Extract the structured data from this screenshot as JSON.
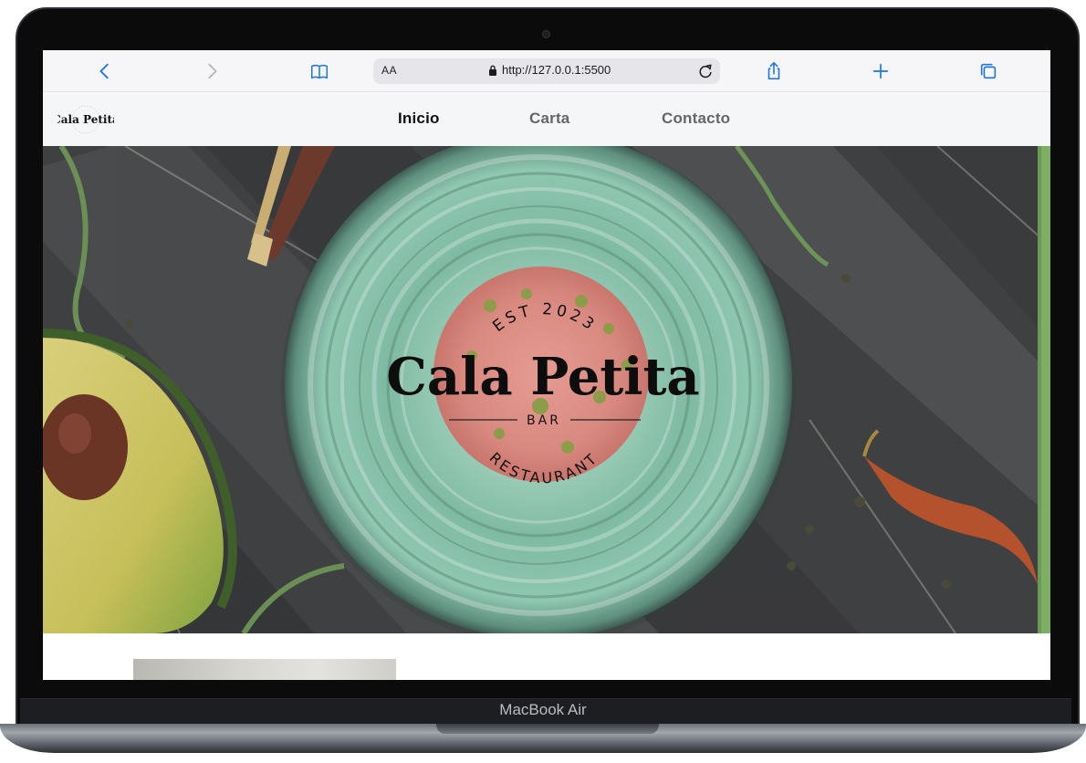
{
  "device": {
    "model_label": "MacBook Air"
  },
  "browser": {
    "text_size_label": "AA",
    "url": "http://127.0.0.1:5500",
    "icons": [
      "back-icon",
      "forward-icon",
      "bookmarks-icon",
      "lock-icon",
      "reload-icon",
      "share-icon",
      "new-tab-icon",
      "tabs-icon"
    ]
  },
  "site": {
    "logo_text": "Cala Petita",
    "nav": [
      {
        "label": "Inicio",
        "active": true
      },
      {
        "label": "Carta",
        "active": false
      },
      {
        "label": "Contacto",
        "active": false
      }
    ],
    "hero_logo": {
      "top_arc": "EST 2023",
      "name": "Cala Petita",
      "middle": "BAR",
      "bottom_arc": "RESTAURANT"
    }
  },
  "colors": {
    "accent": "#1a73e8",
    "plate": "#8fc3ad",
    "wood": "#3d3e40",
    "nav_background": "#f5f6f8"
  }
}
